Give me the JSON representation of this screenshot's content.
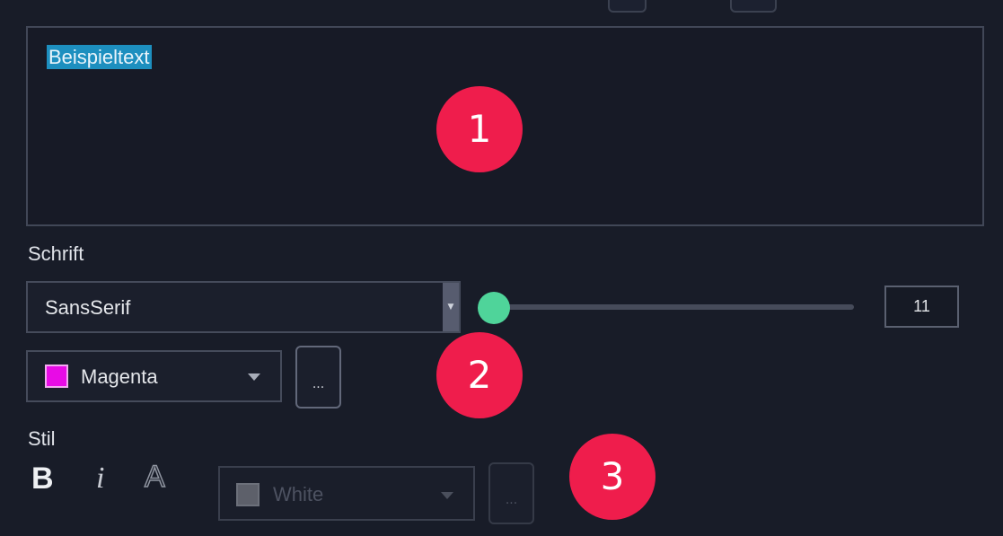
{
  "text_editor": {
    "selected_text": "Beispieltext"
  },
  "badges": [
    "1",
    "2",
    "3"
  ],
  "font": {
    "section_label": "Schrift",
    "family": "SansSerif",
    "dropdown_arrow": "▼",
    "size_slider_value": 0,
    "size": "11"
  },
  "color": {
    "selected": "Magenta",
    "swatch_hex": "#e80be6",
    "more_label": "..."
  },
  "style": {
    "section_label": "Stil",
    "bold_label": "B",
    "italic_label": "i",
    "outline_label": "A",
    "outline_color": "White",
    "outline_swatch_hex": "#5d606a",
    "more_label": "..."
  },
  "colors": {
    "background": "#181c28",
    "accent_badge": "#ef1d4c",
    "selection": "#1d8fbf",
    "slider_thumb": "#4fd49a"
  }
}
